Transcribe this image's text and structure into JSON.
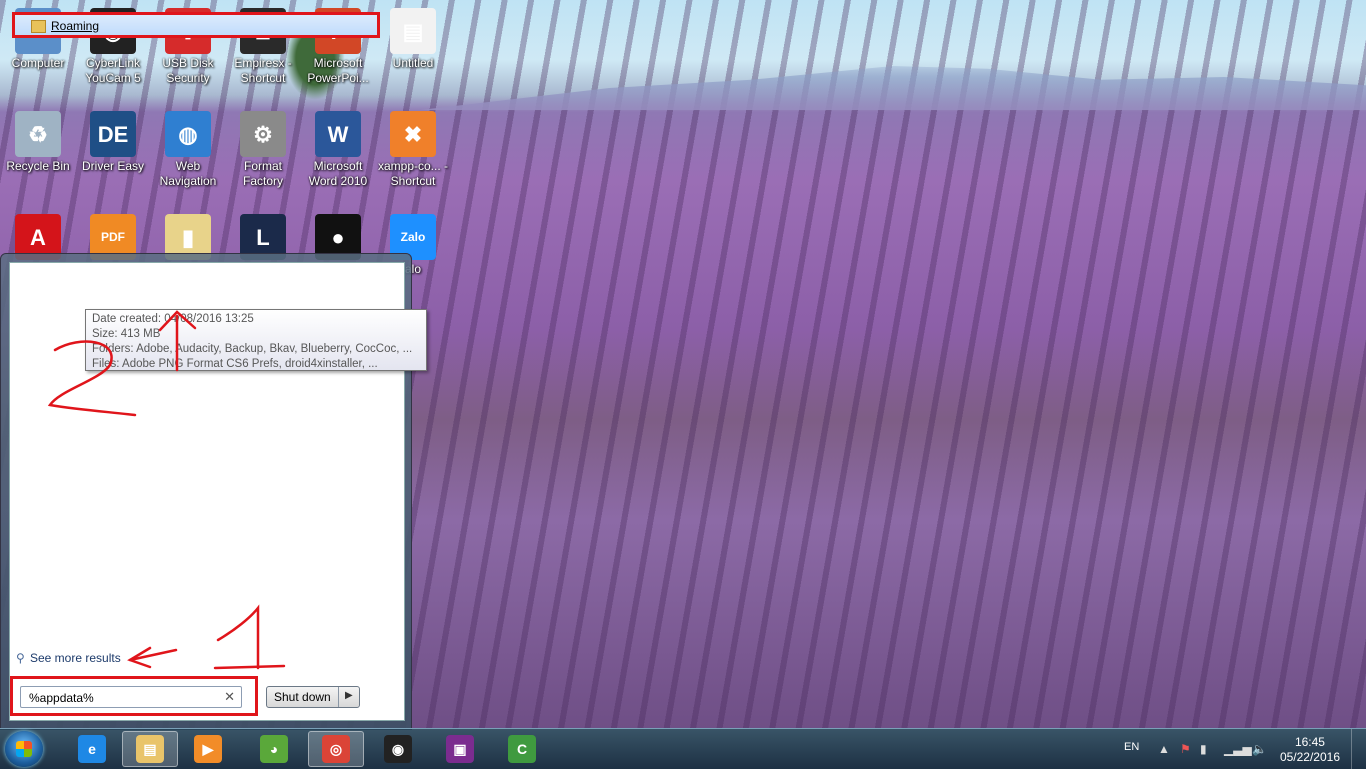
{
  "desktop": {
    "icons": [
      {
        "label": "Computer",
        "glyph": "▭",
        "color": "#5b8fc9"
      },
      {
        "label": "CyberLink YouCam 5",
        "glyph": "◉",
        "color": "#222222"
      },
      {
        "label": "USB Disk Security",
        "glyph": "✚",
        "color": "#d62b2b"
      },
      {
        "label": "Empiresx - Shortcut",
        "glyph": "♜",
        "color": "#2a2a2a"
      },
      {
        "label": "Microsoft PowerPoi...",
        "glyph": "P",
        "color": "#d24726"
      },
      {
        "label": "Untitled",
        "glyph": "▤",
        "color": "#f2f2f2"
      },
      {
        "label": "Recycle Bin",
        "glyph": "♻",
        "color": "#9fb3c4"
      },
      {
        "label": "Driver Easy",
        "glyph": "DE",
        "color": "#1f4f86"
      },
      {
        "label": "Web Navigation",
        "glyph": "◍",
        "color": "#2f7fd1"
      },
      {
        "label": "Format Factory",
        "glyph": "⚙",
        "color": "#8a8a8a"
      },
      {
        "label": "Microsoft Word 2010",
        "glyph": "W",
        "color": "#2b579a"
      },
      {
        "label": "xampp-co... - Shortcut",
        "glyph": "✖",
        "color": "#f0802a"
      },
      {
        "label": "",
        "glyph": "A",
        "color": "#d4141a"
      },
      {
        "label": "",
        "glyph": "PDF",
        "color": "#f08a24"
      },
      {
        "label": "",
        "glyph": "▮",
        "color": "#e8d38a"
      },
      {
        "label": "",
        "glyph": "L",
        "color": "#1b2a4a"
      },
      {
        "label": "",
        "glyph": "●",
        "color": "#111111"
      },
      {
        "label": "alo",
        "glyph": "Zalo",
        "color": "#1e90ff"
      }
    ]
  },
  "start_menu": {
    "result_title": "Roaming",
    "tooltip": {
      "date_created": "Date created: 04/08/2016 13:25",
      "size": "Size: 413 MB",
      "folders": "Folders: Adobe, Audacity, Backup, Bkav, Blueberry, CocCoc, ...",
      "files": "Files: Adobe PNG Format CS6 Prefs, droid4xinstaller, ..."
    },
    "see_more": "See more results",
    "search_value": "%appdata%",
    "shutdown_label": "Shut down"
  },
  "annotations": {
    "number_1": "1",
    "number_2": "2",
    "color": "#e0151b"
  },
  "taskbar": {
    "apps": [
      {
        "name": "internet-explorer",
        "glyph": "e",
        "color": "#1e88e5"
      },
      {
        "name": "file-explorer",
        "glyph": "▤",
        "color": "#e9c46a"
      },
      {
        "name": "media-player",
        "glyph": "▶",
        "color": "#f28c28"
      },
      {
        "name": "coccoc",
        "glyph": "◕",
        "color": "#5aa83a"
      },
      {
        "name": "chrome",
        "glyph": "◎",
        "color": "#db4437"
      },
      {
        "name": "youcam",
        "glyph": "◉",
        "color": "#222222"
      },
      {
        "name": "video-app",
        "glyph": "▣",
        "color": "#7b2c8f"
      },
      {
        "name": "camtasia",
        "glyph": "C",
        "color": "#3f9a3f"
      }
    ],
    "language": "EN",
    "time": "16:45",
    "date": "05/22/2016"
  }
}
